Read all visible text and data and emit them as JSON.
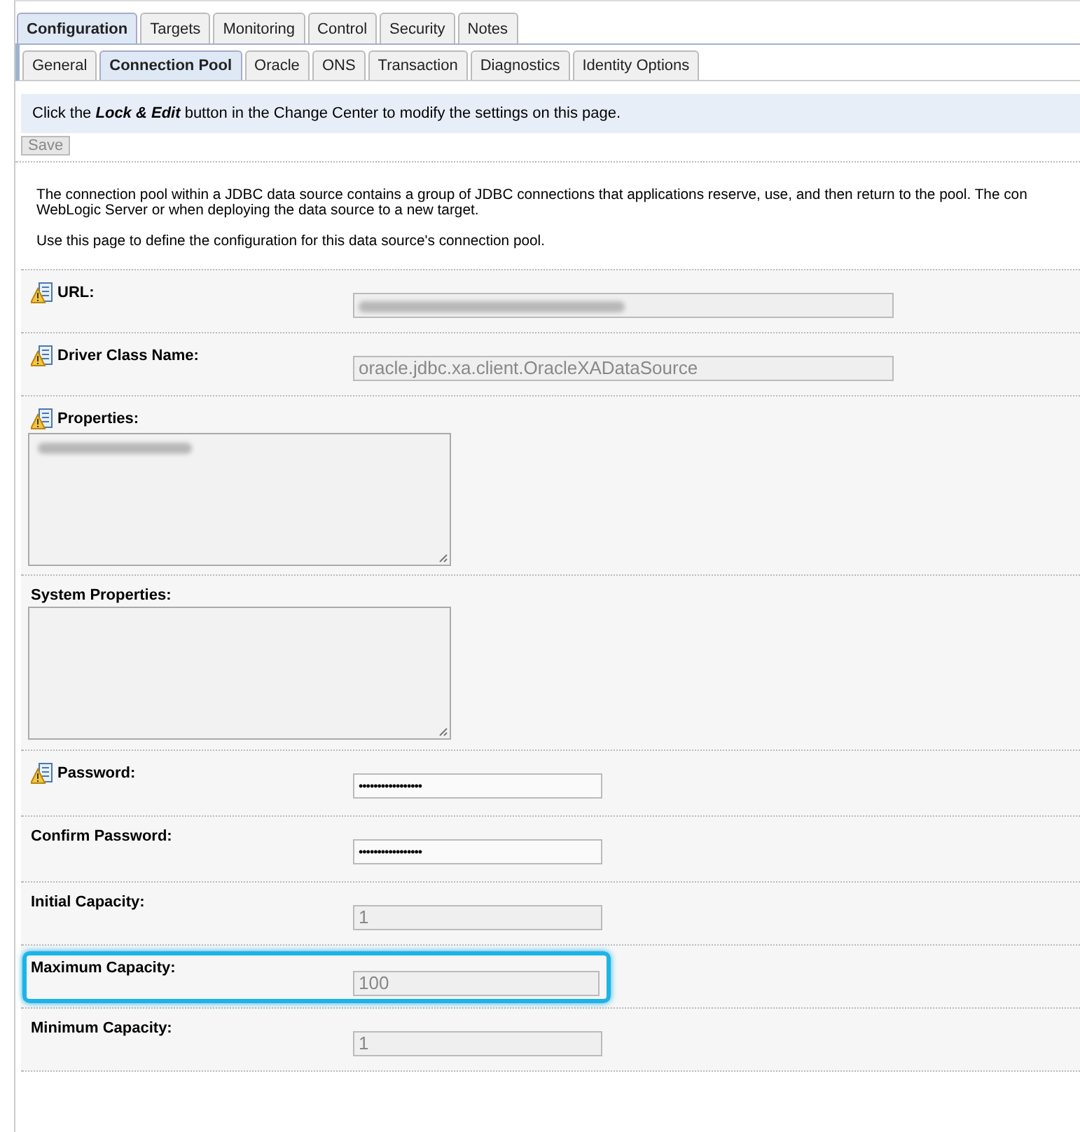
{
  "tabs": [
    {
      "label": "Configuration",
      "selected": true
    },
    {
      "label": "Targets",
      "selected": false
    },
    {
      "label": "Monitoring",
      "selected": false
    },
    {
      "label": "Control",
      "selected": false
    },
    {
      "label": "Security",
      "selected": false
    },
    {
      "label": "Notes",
      "selected": false
    }
  ],
  "subtabs": [
    {
      "label": "General",
      "selected": false
    },
    {
      "label": "Connection Pool",
      "selected": true
    },
    {
      "label": "Oracle",
      "selected": false
    },
    {
      "label": "ONS",
      "selected": false
    },
    {
      "label": "Transaction",
      "selected": false
    },
    {
      "label": "Diagnostics",
      "selected": false
    },
    {
      "label": "Identity Options",
      "selected": false
    }
  ],
  "notice": "Click the **Lock & Edit** button in the Change Center to modify the settings on this page.",
  "save_button": {
    "label": "Save",
    "disabled": true
  },
  "description": [
    "The connection pool within a JDBC data source contains a group of JDBC connections that applications reserve, use, and then return to the pool. The con",
    "WebLogic Server or when deploying the data source to a new target."
  ],
  "usage": "Use this page to define the configuration for this data source's connection pool.",
  "fields": [
    {
      "kind": "text",
      "label": "URL:",
      "warning": true,
      "redacted": true,
      "wide": true,
      "disabled": true,
      "highlighted": false
    },
    {
      "kind": "text",
      "label": "Driver Class Name:",
      "warning": true,
      "value": "oracle.jdbc.xa.client.OracleXADataSource",
      "wide": true,
      "disabled": true,
      "highlighted": false
    },
    {
      "kind": "textarea",
      "label": "Properties:",
      "warning": true,
      "redacted": true,
      "highlighted": false
    },
    {
      "kind": "textarea",
      "label": "System Properties:",
      "warning": false,
      "redacted": false,
      "highlighted": false
    },
    {
      "kind": "password",
      "label": "Password:",
      "warning": true,
      "value": "•••••••••••••••••",
      "highlighted": false
    },
    {
      "kind": "password",
      "label": "Confirm Password:",
      "warning": false,
      "value": "•••••••••••••••••",
      "highlighted": false
    },
    {
      "kind": "text",
      "label": "Initial Capacity:",
      "warning": false,
      "value": "1",
      "wide": false,
      "disabled": true,
      "highlighted": false
    },
    {
      "kind": "text",
      "label": "Maximum Capacity:",
      "warning": false,
      "value": "100",
      "wide": false,
      "disabled": true,
      "highlighted": true
    },
    {
      "kind": "text",
      "label": "Minimum Capacity:",
      "warning": false,
      "value": "1",
      "wide": false,
      "disabled": true,
      "highlighted": false
    }
  ]
}
